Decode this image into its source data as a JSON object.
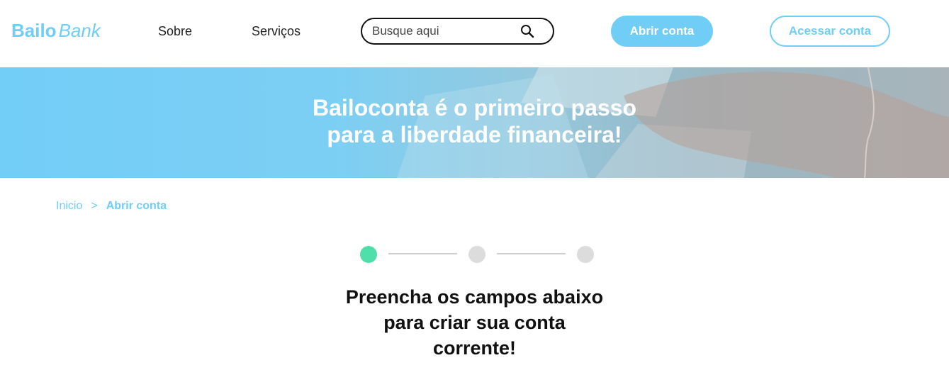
{
  "header": {
    "logo_part1": "Bailo",
    "logo_part2": "Bank",
    "nav": [
      {
        "label": "Sobre"
      },
      {
        "label": "Serviços"
      }
    ],
    "search": {
      "placeholder": "Busque aqui",
      "value": "",
      "icon": "search-icon"
    },
    "primary_button": "Abrir conta",
    "secondary_button": "Acessar conta"
  },
  "hero": {
    "line1": "Bailoconta é o primeiro passo",
    "line2": "para a liberdade financeira!"
  },
  "breadcrumb": {
    "home": "Inicio",
    "separator": ">",
    "current": "Abrir conta"
  },
  "steps": {
    "total": 3,
    "current": 1,
    "active_color": "#4fdfaa",
    "inactive_color": "#dcdcdc"
  },
  "form": {
    "heading_lines": [
      "Preencha os campos abaixo",
      "para criar sua conta",
      "corrente!"
    ]
  },
  "colors": {
    "accent": "#6fcdf6",
    "step_active": "#4fdfaa"
  }
}
